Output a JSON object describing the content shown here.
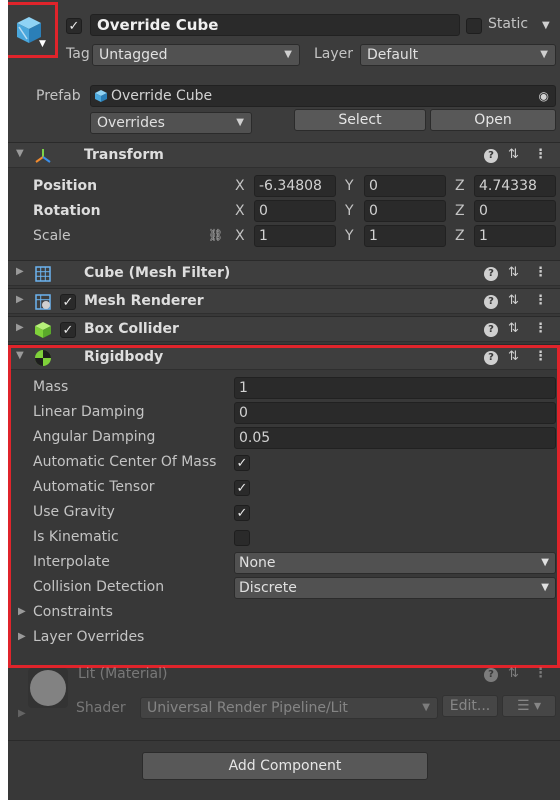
{
  "header": {
    "name": "Override Cube",
    "static_label": "Static",
    "tag_label": "Tag",
    "tag_value": "Untagged",
    "layer_label": "Layer",
    "layer_value": "Default",
    "prefab_label": "Prefab",
    "prefab_value": "Override Cube",
    "overrides_value": "Overrides",
    "select_label": "Select",
    "open_label": "Open"
  },
  "transform": {
    "title": "Transform",
    "position_label": "Position",
    "rotation_label": "Rotation",
    "scale_label": "Scale",
    "axis_x": "X",
    "axis_y": "Y",
    "axis_z": "Z",
    "position": {
      "x": "-6.34808",
      "y": "0",
      "z": "4.74338"
    },
    "rotation": {
      "x": "0",
      "y": "0",
      "z": "0"
    },
    "scale": {
      "x": "1",
      "y": "1",
      "z": "1"
    }
  },
  "components": {
    "mesh_filter": "Cube (Mesh Filter)",
    "mesh_renderer": "Mesh Renderer",
    "box_collider": "Box Collider"
  },
  "rigidbody": {
    "title": "Rigidbody",
    "mass_label": "Mass",
    "mass_value": "1",
    "linear_damping_label": "Linear Damping",
    "linear_damping_value": "0",
    "angular_damping_label": "Angular Damping",
    "angular_damping_value": "0.05",
    "auto_com_label": "Automatic Center Of Mass",
    "auto_tensor_label": "Automatic Tensor",
    "use_gravity_label": "Use Gravity",
    "is_kinematic_label": "Is Kinematic",
    "interpolate_label": "Interpolate",
    "interpolate_value": "None",
    "collision_label": "Collision Detection",
    "collision_value": "Discrete",
    "constraints_label": "Constraints",
    "layer_overrides_label": "Layer Overrides",
    "checkmark": "✓",
    "auto_com_checked": true,
    "auto_tensor_checked": true,
    "use_gravity_checked": true,
    "is_kinematic_checked": false
  },
  "material": {
    "title": "Lit (Material)",
    "shader_label": "Shader",
    "shader_value": "Universal Render Pipeline/Lit",
    "edit_label": "Edit..."
  },
  "footer": {
    "add_component_label": "Add Component"
  },
  "colors": {
    "highlight": "#e0242b",
    "panel_bg": "#383838",
    "header_bg": "#3e3e3e"
  }
}
